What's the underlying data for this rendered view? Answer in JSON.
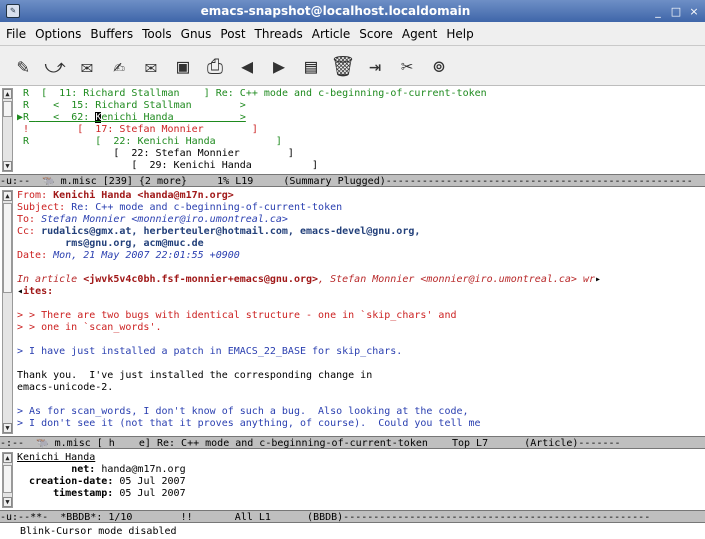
{
  "window": {
    "title": "emacs-snapshot@localhost.localdomain",
    "controls": [
      "_",
      "□",
      "×"
    ]
  },
  "menu": [
    "File",
    "Options",
    "Buffers",
    "Tools",
    "Gnus",
    "Post",
    "Threads",
    "Article",
    "Score",
    "Agent",
    "Help"
  ],
  "toolbar_icons": [
    "edit-icon",
    "followup-icon",
    "reply-icon",
    "reply-with-citation-icon",
    "mail-icon",
    "save-icon",
    "print-icon",
    "previous-icon",
    "next-icon",
    "kill-thread-icon",
    "trash-icon",
    "exit-icon",
    "preferences-icon",
    "help-icon"
  ],
  "summary": {
    "lines": [
      {
        "mark": "R",
        "text": "[  11: Richard Stallman",
        "tail": "] Re: C++ mode and c-beginning-of-current-token"
      },
      {
        "mark": "R",
        "text": "   <  15: Richard Stallman        >"
      },
      {
        "mark": "R",
        "text": "   <  62: ",
        "name": "Kenichi Handa",
        "tail": "           >"
      },
      {
        "mark": "!",
        "text": "      [  17: Stefan Monnier        ]"
      },
      {
        "mark": "R",
        "text": "         [  22: Kenichi Handa          ]"
      },
      {
        "mark": "",
        "text": "            [  22: Stefan Monnier        ]"
      },
      {
        "mark": "",
        "text": "               [  29: Kenichi Handa          ]"
      }
    ],
    "modeline_left": "-u:--",
    "modeline_rest": " m.misc [239] {2 more}     1% L19     (Summary Plugged)---------------------------------------------------"
  },
  "article": {
    "from_label": "From:",
    "from_value": "Kenichi Handa <handa@m17n.org>",
    "subject_label": "Subject:",
    "subject_value": "Re: C++ mode and c-beginning-of-current-token",
    "to_label": "To:",
    "to_value": "Stefan Monnier <monnier@iro.umontreal.ca>",
    "cc_label": "Cc:",
    "cc_value1": "rudalics@gmx.at, herberteuler@hotmail.com, emacs-devel@gnu.org,",
    "cc_value2": "rms@gnu.org, acm@muc.de",
    "date_label": "Date:",
    "date_value": "Mon, 21 May 2007 22:01:55 +0900",
    "intro_pre": "In article ",
    "intro_id": "<jwvk5v4c0bh.fsf-monnier+emacs@gnu.org>",
    "intro_mid": ", Stefan Monnier ",
    "intro_addr": "<monnier@iro.umontreal.ca>",
    "intro_end": " wr",
    "intro_wrap": "ites:",
    "q1": "> > There are two bugs with identical structure - one in `skip_chars' and",
    "q2": "> > one in `scan_words'.",
    "q3": "> I have just installed a patch in EMACS_22_BASE for skip_chars.",
    "p1": "Thank you.  I've just installed the corresponding change in",
    "p2": "emacs-unicode-2.",
    "q4": "> As for scan_words, I don't know of such a bug.  Also looking at the code,",
    "q5": "> I don't see it (not that it proves anything, of course).  Could you tell me",
    "modeline_left": "-:--",
    "modeline_rest": " m.misc [ h    e] Re: C++ mode and c-beginning-of-current-token    Top L7      (Article)-------"
  },
  "bbdb": {
    "name": "Kenichi Handa",
    "fields": [
      {
        "label": "net:",
        "value": "handa@m17n.org"
      },
      {
        "label": "creation-date:",
        "value": "05 Jul 2007"
      },
      {
        "label": "timestamp:",
        "value": "05 Jul 2007"
      }
    ],
    "modeline": "-u:--**-  *BBDB*: 1/10        !!       All L1      (BBDB)---------------------------------------------------"
  },
  "echo": "Blink-Cursor mode disabled"
}
